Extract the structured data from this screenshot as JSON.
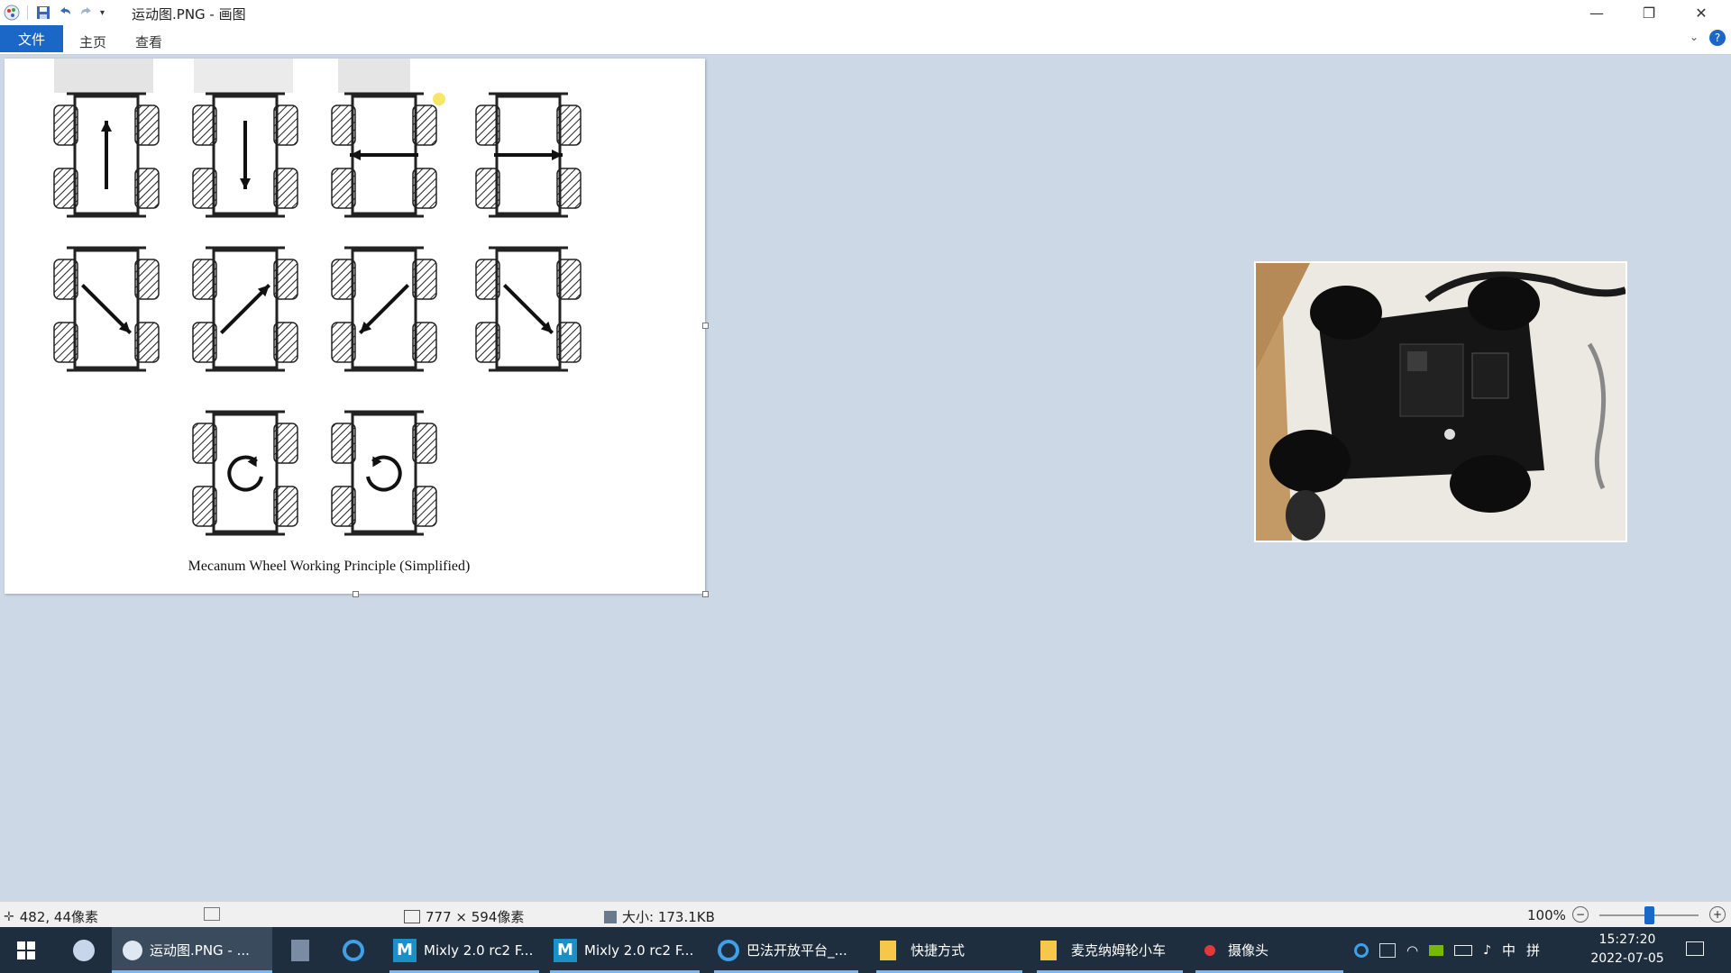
{
  "window": {
    "title": "运动图.PNG - 画图",
    "minimize": "—",
    "restore": "❐",
    "close": "✕"
  },
  "ribbon": {
    "tabs": [
      "文件",
      "主页",
      "查看"
    ],
    "help": "?"
  },
  "canvas": {
    "caption": "Mecanum Wheel Working Principle (Simplified)"
  },
  "statusbar": {
    "cursor_pos": "482, 44像素",
    "dimensions": "777 × 594像素",
    "filesize": "大小: 173.1KB",
    "zoom": "100%",
    "zoom_fraction": 0.5
  },
  "taskbar": {
    "items": [
      {
        "label": "运动图.PNG - ...",
        "active": true
      },
      {
        "label": "Mixly 2.0 rc2 F..."
      },
      {
        "label": "Mixly 2.0 rc2 F..."
      },
      {
        "label": "巴法开放平台_..."
      },
      {
        "label": "快捷方式"
      },
      {
        "label": "麦克纳姆轮小车"
      },
      {
        "label": "摄像头"
      }
    ],
    "ime": "中",
    "ime2": "拼",
    "time": "15:27:20",
    "date": "2022-07-05"
  },
  "colors": {
    "accent": "#1a67c7",
    "taskbar_bg": "#1f2e3e",
    "workspace_bg": "#cdd8e6"
  }
}
